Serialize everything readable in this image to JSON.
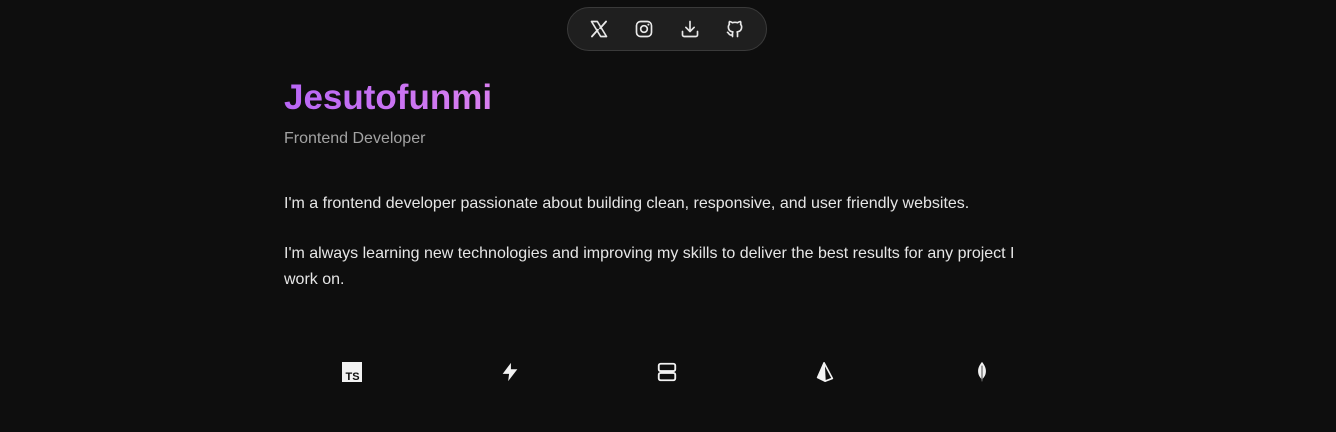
{
  "social": {
    "items": [
      {
        "icon": "x-icon",
        "label": "X"
      },
      {
        "icon": "instagram-icon",
        "label": "Instagram"
      },
      {
        "icon": "download-icon",
        "label": "Download"
      },
      {
        "icon": "github-icon",
        "label": "GitHub"
      }
    ]
  },
  "profile": {
    "name": "Jesutofunmi",
    "role": "Frontend Developer",
    "paragraphs": [
      "I'm a frontend developer passionate about building clean, responsive, and user friendly websites.",
      "I'm always learning new technologies and improving my skills to deliver the best results for any project I work on."
    ]
  },
  "tech": {
    "icons": [
      "typescript-icon",
      "bolt-icon",
      "server-icon",
      "prisma-icon",
      "mongodb-leaf-icon"
    ],
    "ts_text": "TS"
  },
  "colors": {
    "background": "#0e0e0e",
    "accent_start": "#b866f5",
    "accent_end": "#d97ff0",
    "muted": "#a3a3a3",
    "text": "#e6e6e6"
  }
}
